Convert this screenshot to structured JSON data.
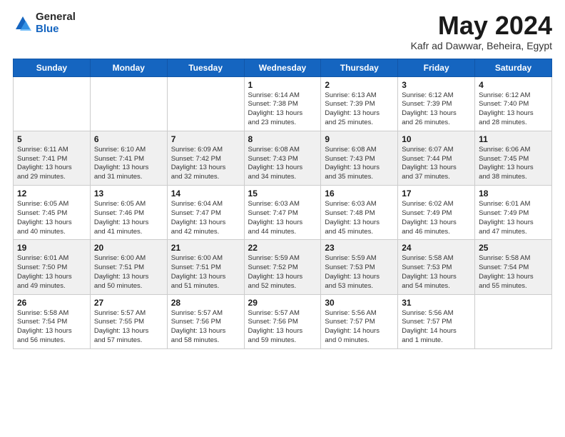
{
  "header": {
    "logo_general": "General",
    "logo_blue": "Blue",
    "title": "May 2024",
    "subtitle": "Kafr ad Dawwar, Beheira, Egypt"
  },
  "weekdays": [
    "Sunday",
    "Monday",
    "Tuesday",
    "Wednesday",
    "Thursday",
    "Friday",
    "Saturday"
  ],
  "weeks": [
    [
      {
        "day": "",
        "info": ""
      },
      {
        "day": "",
        "info": ""
      },
      {
        "day": "",
        "info": ""
      },
      {
        "day": "1",
        "info": "Sunrise: 6:14 AM\nSunset: 7:38 PM\nDaylight: 13 hours\nand 23 minutes."
      },
      {
        "day": "2",
        "info": "Sunrise: 6:13 AM\nSunset: 7:39 PM\nDaylight: 13 hours\nand 25 minutes."
      },
      {
        "day": "3",
        "info": "Sunrise: 6:12 AM\nSunset: 7:39 PM\nDaylight: 13 hours\nand 26 minutes."
      },
      {
        "day": "4",
        "info": "Sunrise: 6:12 AM\nSunset: 7:40 PM\nDaylight: 13 hours\nand 28 minutes."
      }
    ],
    [
      {
        "day": "5",
        "info": "Sunrise: 6:11 AM\nSunset: 7:41 PM\nDaylight: 13 hours\nand 29 minutes."
      },
      {
        "day": "6",
        "info": "Sunrise: 6:10 AM\nSunset: 7:41 PM\nDaylight: 13 hours\nand 31 minutes."
      },
      {
        "day": "7",
        "info": "Sunrise: 6:09 AM\nSunset: 7:42 PM\nDaylight: 13 hours\nand 32 minutes."
      },
      {
        "day": "8",
        "info": "Sunrise: 6:08 AM\nSunset: 7:43 PM\nDaylight: 13 hours\nand 34 minutes."
      },
      {
        "day": "9",
        "info": "Sunrise: 6:08 AM\nSunset: 7:43 PM\nDaylight: 13 hours\nand 35 minutes."
      },
      {
        "day": "10",
        "info": "Sunrise: 6:07 AM\nSunset: 7:44 PM\nDaylight: 13 hours\nand 37 minutes."
      },
      {
        "day": "11",
        "info": "Sunrise: 6:06 AM\nSunset: 7:45 PM\nDaylight: 13 hours\nand 38 minutes."
      }
    ],
    [
      {
        "day": "12",
        "info": "Sunrise: 6:05 AM\nSunset: 7:45 PM\nDaylight: 13 hours\nand 40 minutes."
      },
      {
        "day": "13",
        "info": "Sunrise: 6:05 AM\nSunset: 7:46 PM\nDaylight: 13 hours\nand 41 minutes."
      },
      {
        "day": "14",
        "info": "Sunrise: 6:04 AM\nSunset: 7:47 PM\nDaylight: 13 hours\nand 42 minutes."
      },
      {
        "day": "15",
        "info": "Sunrise: 6:03 AM\nSunset: 7:47 PM\nDaylight: 13 hours\nand 44 minutes."
      },
      {
        "day": "16",
        "info": "Sunrise: 6:03 AM\nSunset: 7:48 PM\nDaylight: 13 hours\nand 45 minutes."
      },
      {
        "day": "17",
        "info": "Sunrise: 6:02 AM\nSunset: 7:49 PM\nDaylight: 13 hours\nand 46 minutes."
      },
      {
        "day": "18",
        "info": "Sunrise: 6:01 AM\nSunset: 7:49 PM\nDaylight: 13 hours\nand 47 minutes."
      }
    ],
    [
      {
        "day": "19",
        "info": "Sunrise: 6:01 AM\nSunset: 7:50 PM\nDaylight: 13 hours\nand 49 minutes."
      },
      {
        "day": "20",
        "info": "Sunrise: 6:00 AM\nSunset: 7:51 PM\nDaylight: 13 hours\nand 50 minutes."
      },
      {
        "day": "21",
        "info": "Sunrise: 6:00 AM\nSunset: 7:51 PM\nDaylight: 13 hours\nand 51 minutes."
      },
      {
        "day": "22",
        "info": "Sunrise: 5:59 AM\nSunset: 7:52 PM\nDaylight: 13 hours\nand 52 minutes."
      },
      {
        "day": "23",
        "info": "Sunrise: 5:59 AM\nSunset: 7:53 PM\nDaylight: 13 hours\nand 53 minutes."
      },
      {
        "day": "24",
        "info": "Sunrise: 5:58 AM\nSunset: 7:53 PM\nDaylight: 13 hours\nand 54 minutes."
      },
      {
        "day": "25",
        "info": "Sunrise: 5:58 AM\nSunset: 7:54 PM\nDaylight: 13 hours\nand 55 minutes."
      }
    ],
    [
      {
        "day": "26",
        "info": "Sunrise: 5:58 AM\nSunset: 7:54 PM\nDaylight: 13 hours\nand 56 minutes."
      },
      {
        "day": "27",
        "info": "Sunrise: 5:57 AM\nSunset: 7:55 PM\nDaylight: 13 hours\nand 57 minutes."
      },
      {
        "day": "28",
        "info": "Sunrise: 5:57 AM\nSunset: 7:56 PM\nDaylight: 13 hours\nand 58 minutes."
      },
      {
        "day": "29",
        "info": "Sunrise: 5:57 AM\nSunset: 7:56 PM\nDaylight: 13 hours\nand 59 minutes."
      },
      {
        "day": "30",
        "info": "Sunrise: 5:56 AM\nSunset: 7:57 PM\nDaylight: 14 hours\nand 0 minutes."
      },
      {
        "day": "31",
        "info": "Sunrise: 5:56 AM\nSunset: 7:57 PM\nDaylight: 14 hours\nand 1 minute."
      },
      {
        "day": "",
        "info": ""
      }
    ]
  ]
}
